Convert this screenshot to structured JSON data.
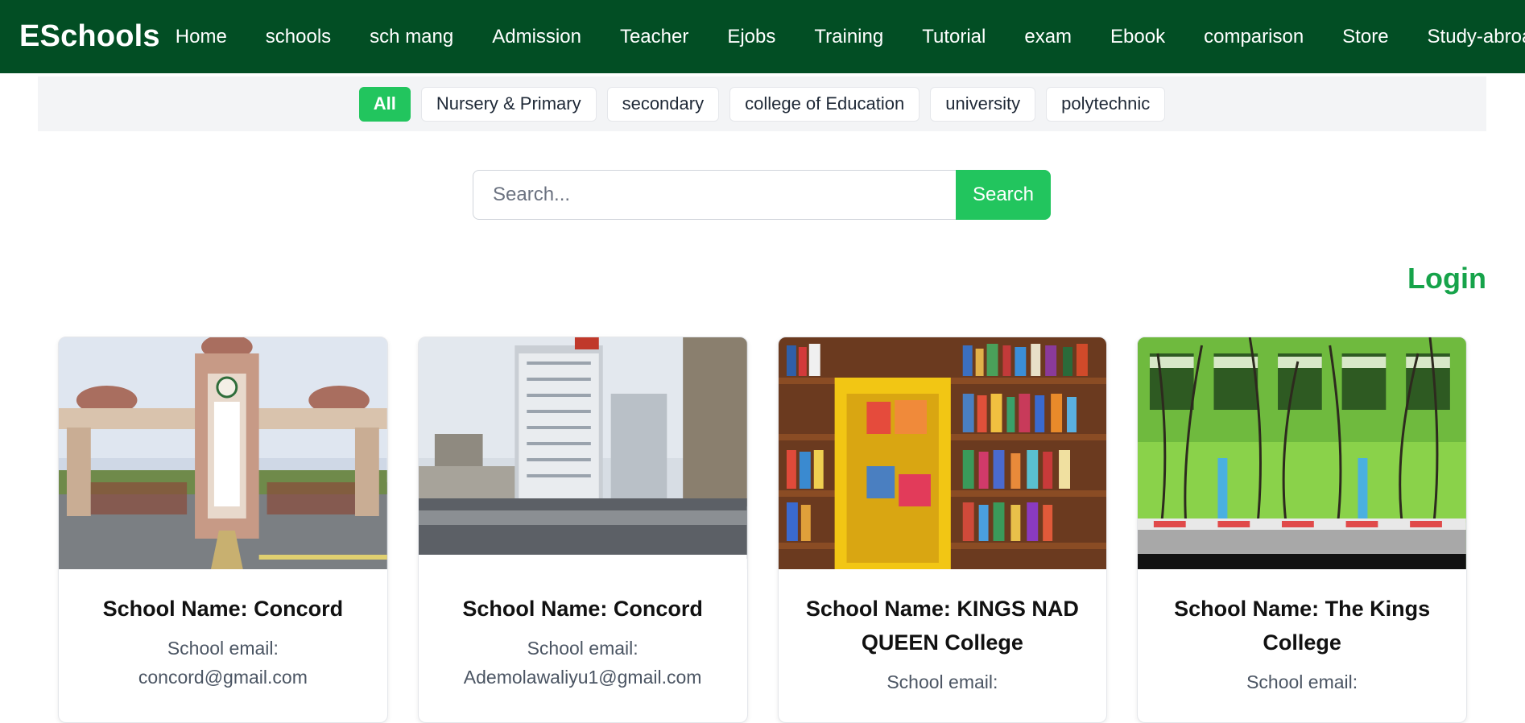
{
  "navbar": {
    "brand": "ESchools",
    "links": [
      "Home",
      "schools",
      "sch mang",
      "Admission",
      "Teacher",
      "Ejobs",
      "Training",
      "Tutorial",
      "exam",
      "Ebook",
      "comparison",
      "Store",
      "Study-abroad"
    ]
  },
  "filters": {
    "items": [
      "All",
      "Nursery & Primary",
      "secondary",
      "college of Education",
      "university",
      "polytechnic"
    ],
    "active": "All"
  },
  "search": {
    "placeholder": "Search...",
    "value": "",
    "button_label": "Search"
  },
  "login_label": "Login",
  "colors": {
    "navbar_bg": "#024e24",
    "accent": "#22c55e",
    "login": "#16a34a"
  },
  "cards": [
    {
      "title": "School Name: Concord",
      "email_label": "School email:",
      "email": "concord@gmail.com",
      "image": "gate-photo"
    },
    {
      "title": "School Name: Concord",
      "email_label": "School email:",
      "email": "Ademolawaliyu1@gmail.com",
      "image": "city-buildings-photo"
    },
    {
      "title": "School Name: KINGS NAD QUEEN College",
      "email_label": "School email:",
      "email": "",
      "image": "bookshelf-photo"
    },
    {
      "title": "School Name: The Kings College",
      "email_label": "School email:",
      "email": "",
      "image": "green-building-photo"
    }
  ]
}
